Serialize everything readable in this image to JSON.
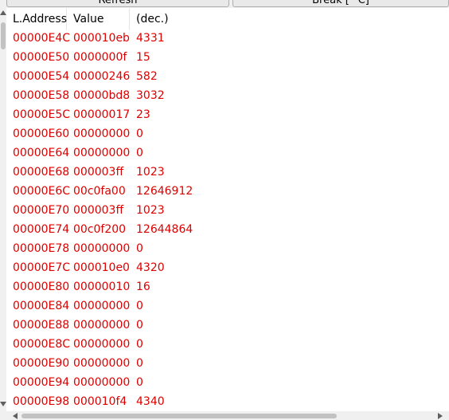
{
  "toolbar": {
    "refresh_label": "Refresh",
    "break_label": "Break [^C]"
  },
  "table": {
    "columns": [
      "L.Address",
      "Value",
      "(dec.)"
    ],
    "rows": [
      [
        "00000E4C",
        "000010eb",
        "4331"
      ],
      [
        "00000E50",
        "0000000f",
        "15"
      ],
      [
        "00000E54",
        "00000246",
        "582"
      ],
      [
        "00000E58",
        "00000bd8",
        "3032"
      ],
      [
        "00000E5C",
        "00000017",
        "23"
      ],
      [
        "00000E60",
        "00000000",
        "0"
      ],
      [
        "00000E64",
        "00000000",
        "0"
      ],
      [
        "00000E68",
        "000003ff",
        "1023"
      ],
      [
        "00000E6C",
        "00c0fa00",
        "12646912"
      ],
      [
        "00000E70",
        "000003ff",
        "1023"
      ],
      [
        "00000E74",
        "00c0f200",
        "12644864"
      ],
      [
        "00000E78",
        "00000000",
        "0"
      ],
      [
        "00000E7C",
        "000010e0",
        "4320"
      ],
      [
        "00000E80",
        "00000010",
        "16"
      ],
      [
        "00000E84",
        "00000000",
        "0"
      ],
      [
        "00000E88",
        "00000000",
        "0"
      ],
      [
        "00000E8C",
        "00000000",
        "0"
      ],
      [
        "00000E90",
        "00000000",
        "0"
      ],
      [
        "00000E94",
        "00000000",
        "0"
      ],
      [
        "00000E98",
        "000010f4",
        "4340"
      ]
    ]
  },
  "colors": {
    "row_text": "#dd0000",
    "header_text": "#000000",
    "scrollbar": "#f0f0f0",
    "scroll_thumb": "#c2c2c2"
  },
  "icons": {
    "scroll_up": "up-arrow-icon",
    "scroll_down": "down-arrow-icon",
    "scroll_left": "left-arrow-icon",
    "scroll_right": "right-arrow-icon"
  }
}
